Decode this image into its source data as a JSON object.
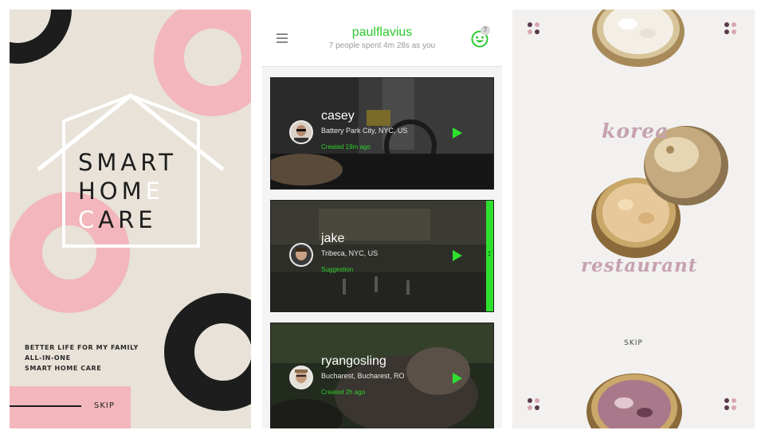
{
  "panel_smart_home": {
    "title_line1": "SMART",
    "title_line2_dark": "HOM",
    "title_line2_light": "E",
    "title_line3_light": "C",
    "title_line3_dark": "ARE",
    "tagline_1": "BETTER LIFE FOR MY FAMILY",
    "tagline_2": "ALL-IN-ONE",
    "tagline_3": "SMART HOME CARE",
    "skip_label": "SKIP",
    "colors": {
      "background": "#e8e2d8",
      "pink": "#f2b6bc",
      "dark": "#1d1d1d"
    }
  },
  "panel_feed": {
    "username": "paulflavius",
    "stats": "7 people spent 4m 28s as you",
    "notification_count": "7",
    "menu_icon": "hamburger-icon",
    "profile_icon": "smiley-icon",
    "accent_color": "#2ec82e",
    "cards": [
      {
        "name": "casey",
        "location": "Battery Park City, NYC, US",
        "meta": "Created 19m ago"
      },
      {
        "name": "jake",
        "location": "Tribeca, NYC, US",
        "meta": "Suggestion"
      },
      {
        "name": "ryangosling",
        "location": "Bucharest, Bucharest, RO",
        "meta": "Created 2h ago"
      }
    ]
  },
  "panel_korea": {
    "word_1": "korea",
    "word_2": "restaurant",
    "skip_label": "SKIP",
    "colors": {
      "background": "#f2f1ef",
      "accent": "#c7a2b0"
    }
  }
}
